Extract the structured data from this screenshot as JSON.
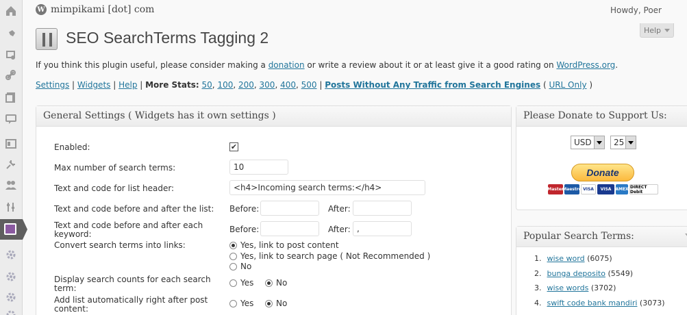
{
  "header": {
    "site_title": "mimpikami [dot] com",
    "howdy": "Howdy, Poer",
    "help_label": "Help"
  },
  "page": {
    "title": "SEO SearchTerms Tagging 2",
    "intro_before": "If you think this plugin useful, please consider making a ",
    "intro_link_donation": "donation",
    "intro_middle": " or write a review about it or at least give it a good rating on ",
    "intro_link_wp": "WordPress.org",
    "intro_after": "."
  },
  "links": {
    "settings": "Settings",
    "widgets": "Widgets",
    "help": "Help",
    "more_stats_label": "More Stats:",
    "stats": [
      "50",
      "100",
      "200",
      "300",
      "400",
      "500"
    ],
    "no_traffic": "Posts Without Any Traffic from Search Engines",
    "paren_open": " ( ",
    "url_only": "URL Only",
    "paren_close": " )",
    "sep": " | "
  },
  "general": {
    "title": "General Settings ( Widgets has it own settings )",
    "enabled_label": "Enabled:",
    "enabled_check": "✔",
    "max_label": "Max number of search terms:",
    "max_value": "10",
    "header_label": "Text and code for list header:",
    "header_value": "<h4>Incoming search terms:</h4>",
    "list_label": "Text and code before and after the list:",
    "before_label": "Before:",
    "after_label": "After:",
    "keyword_label": "Text and code before and after each keyword:",
    "keyword_after_value": ",",
    "convert_label": "Convert search terms into links:",
    "convert_opt1": "Yes, link to post content",
    "convert_opt2": "Yes, link to search page ( Not Recommended )",
    "convert_opt3": "No",
    "counts_label": "Display search counts for each search term:",
    "autoadd_label": "Add list automatically right after post content:",
    "yes": "Yes",
    "no": "No"
  },
  "donate": {
    "title": "Please Donate to Support Us:",
    "currency": "USD",
    "amount": "25",
    "button": "Donate",
    "cards": [
      "Master",
      "Maestro",
      "VISA",
      "VISA",
      "AMEX",
      "DIRECT Debit"
    ]
  },
  "popular": {
    "title": "Popular Search Terms:",
    "items": [
      {
        "num": "1.",
        "term": "wise word",
        "count": "(6075)"
      },
      {
        "num": "2.",
        "term": "bunga deposito",
        "count": "(5549)"
      },
      {
        "num": "3.",
        "term": "wise words",
        "count": "(3702)"
      },
      {
        "num": "4.",
        "term": "swift code bank mandiri",
        "count": "(3073)"
      }
    ]
  }
}
